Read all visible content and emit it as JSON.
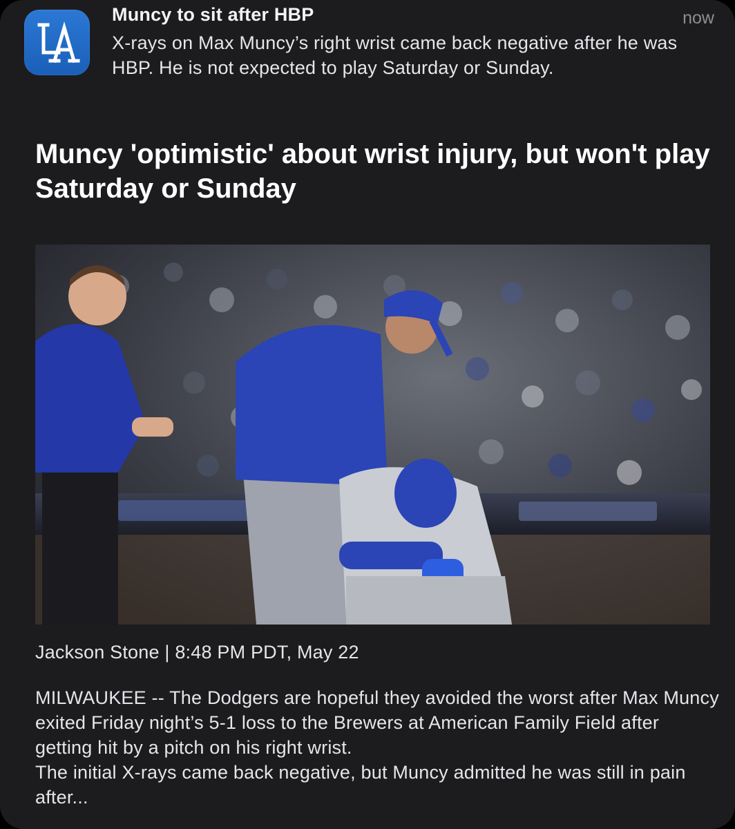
{
  "notification": {
    "app_icon": "la-dodgers-logo-icon",
    "title": "Muncy to sit after HBP",
    "time": "now",
    "body": "X-rays on Max Muncy’s right wrist came back negative after he was HBP. He is not expected to play Saturday or Sunday."
  },
  "article": {
    "headline": "Muncy 'optimistic' about wrist injury, but won't play Saturday or Sunday",
    "byline": "Jackson Stone | 8:48 PM PDT, May 22",
    "paragraphs": [
      "MILWAUKEE -- The Dodgers are hopeful they avoided the worst after Max Muncy exited Friday night’s 5-1 loss to the Brewers at American Family Field after getting hit by a pitch on his right wrist.",
      "The initial X-rays came back negative, but Muncy admitted he was still in pain after..."
    ]
  },
  "colors": {
    "card_background": "#1c1c1e",
    "dodger_blue": "#1e3a9e",
    "app_icon_blue": "#2b78d4",
    "text_primary": "#ffffff",
    "text_secondary": "#8e8e93"
  }
}
